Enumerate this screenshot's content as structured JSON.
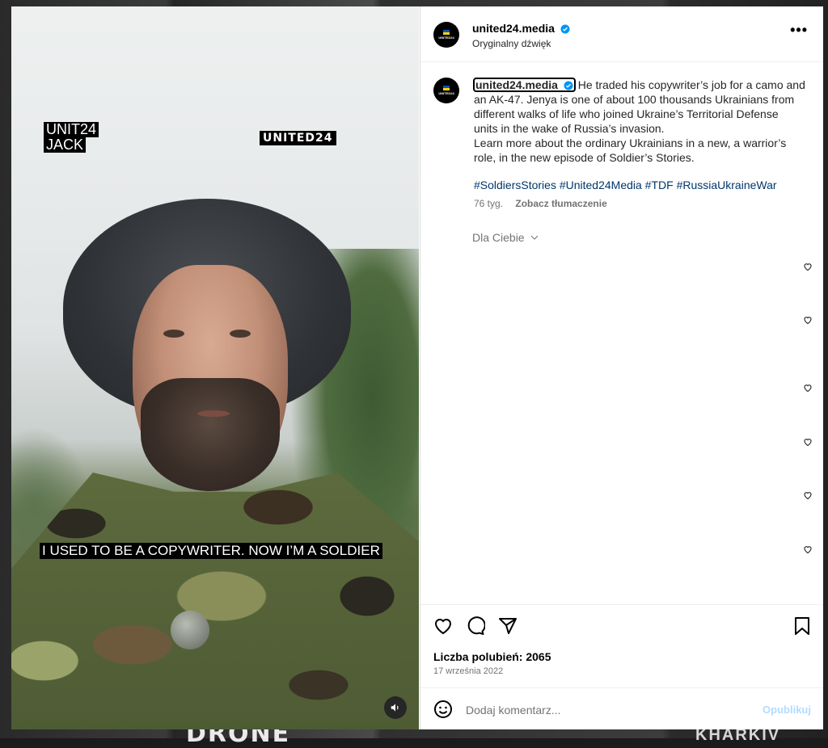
{
  "backdrop": {
    "text_bottom": "DRONE",
    "text_bottom_right": "KHARKIV"
  },
  "video": {
    "tag_left_line1": "UNIT24",
    "tag_left_line2": "JACK",
    "tag_right": "UNITED24",
    "subtitle": "I USED TO BE A COPYWRITER. NOW I’M A SOLDIER"
  },
  "header": {
    "username": "united24.media",
    "audio": "Oryginalny dźwięk",
    "more": "•••",
    "avatar_text": "UNITED24"
  },
  "caption": {
    "username": "united24.media",
    "text": "He traded his copywriter’s job for a camo and an AK-47. Jenya is one of about 100 thousands Ukrainians from different walks of life who joined Ukraine’s Territorial Defense units in the wake of Russia’s invasion.",
    "text2": "Learn more about the ordinary Ukrainians in a new, a warrior’s role, in the new episode of Soldier’s Stories.",
    "hashtags": "#SoldiersStories #United24Media #TDF #RussiaUkraineWar",
    "age": "76 tyg.",
    "translate": "Zobacz tłumaczenie",
    "for_you": "Dla Ciebie"
  },
  "engagement": {
    "likes": "Liczba polubień: 2065",
    "date": "17 września 2022"
  },
  "comment": {
    "placeholder": "Dodaj komentarz...",
    "publish": "Opublikuj"
  },
  "colors": {
    "verified": "#0095f6",
    "link": "#00376b",
    "publish_disabled": "#b3dbff"
  }
}
